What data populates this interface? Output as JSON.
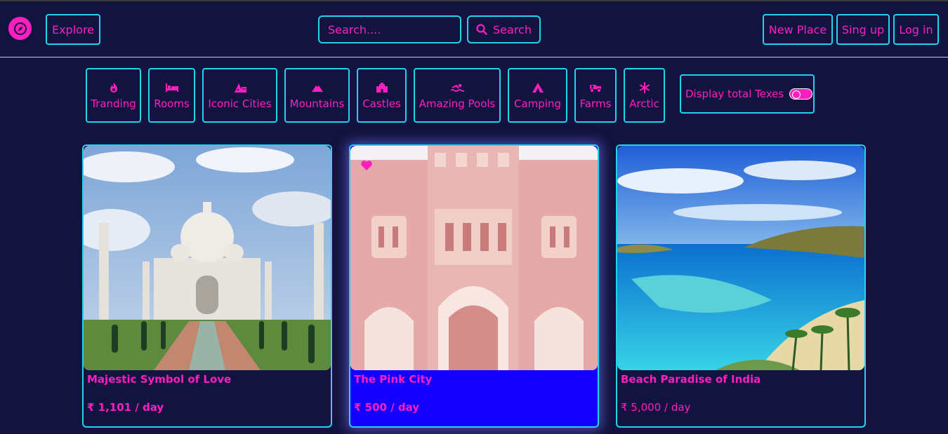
{
  "nav": {
    "logo_icon": "compass-icon",
    "explore_label": "Explore",
    "search_placeholder": "Search....",
    "search_button_label": "Search",
    "new_place_label": "New Place",
    "signup_label": "Sing up",
    "login_label": "Log in"
  },
  "filters": [
    {
      "label": "Tranding",
      "icon": "fire-icon"
    },
    {
      "label": "Rooms",
      "icon": "bed-icon"
    },
    {
      "label": "Iconic Cities",
      "icon": "city-icon"
    },
    {
      "label": "Mountains",
      "icon": "mountain-icon"
    },
    {
      "label": "Castles",
      "icon": "castle-icon"
    },
    {
      "label": "Amazing Pools",
      "icon": "swimmer-icon"
    },
    {
      "label": "Camping",
      "icon": "tent-icon"
    },
    {
      "label": "Farms",
      "icon": "tractor-icon"
    },
    {
      "label": "Arctic",
      "icon": "snowflake-icon"
    }
  ],
  "tax_toggle": {
    "label": "Display total Texes"
  },
  "listings": [
    {
      "title": "Majestic Symbol of Love",
      "price": "₹ 1,101 / day"
    },
    {
      "title": "The Pink City",
      "price": "₹ 500 / day"
    },
    {
      "title": "Beach Paradise of India",
      "price": "₹ 5,000 / day"
    }
  ],
  "colors": {
    "background": "#13133f",
    "accent": "#ff1fc0",
    "border": "#22d3ee",
    "active_card": "#1500ff"
  }
}
